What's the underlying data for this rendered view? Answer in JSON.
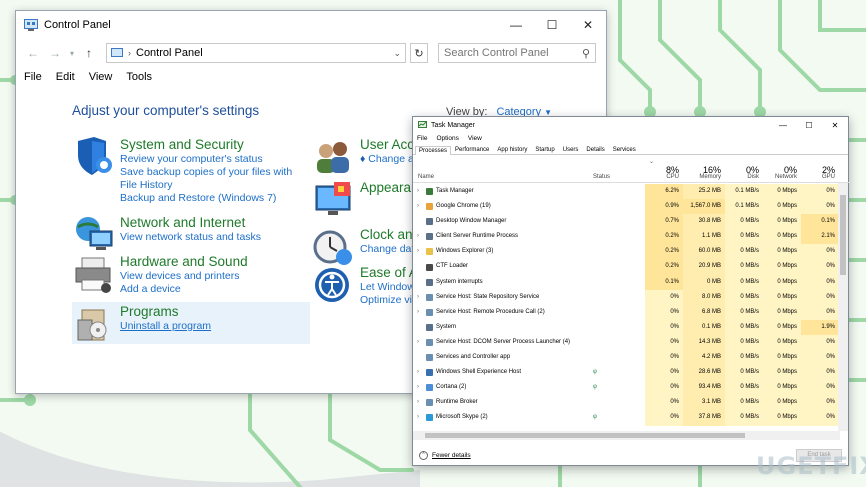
{
  "colors": {
    "accent": "#1e6fc8",
    "heading_green": "#1e7a2a",
    "circuit": "#8fd09a"
  },
  "control_panel": {
    "title": "Control Panel",
    "breadcrumb": "Control Panel",
    "search_placeholder": "Search Control Panel",
    "menu": [
      "File",
      "Edit",
      "View",
      "Tools"
    ],
    "adjust_heading": "Adjust your computer's settings",
    "view_by_label": "View by:",
    "view_by_value": "Category",
    "categories_left": [
      {
        "heading": "System and Security",
        "links": [
          "Review your computer's status",
          "Save backup copies of your files with File History",
          "Backup and Restore (Windows 7)"
        ],
        "icon": "shield-icon"
      },
      {
        "heading": "Network and Internet",
        "links": [
          "View network status and tasks"
        ],
        "icon": "network-icon"
      },
      {
        "heading": "Hardware and Sound",
        "links": [
          "View devices and printers",
          "Add a device"
        ],
        "icon": "printer-icon"
      },
      {
        "heading": "Programs",
        "links": [
          "Uninstall a program"
        ],
        "icon": "programs-icon"
      }
    ],
    "categories_right": [
      {
        "heading": "User Acco",
        "links": [
          "Change ac"
        ],
        "icon": "users-icon"
      },
      {
        "heading": "Appearan",
        "links": [],
        "icon": "appearance-icon"
      },
      {
        "heading": "Clock and",
        "links": [
          "Change date"
        ],
        "icon": "clock-icon"
      },
      {
        "heading": "Ease of Ac",
        "links": [
          "Let Windows",
          "Optimize visu"
        ],
        "icon": "ease-of-access-icon"
      }
    ]
  },
  "task_manager": {
    "title": "Task Manager",
    "menu": [
      "File",
      "Options",
      "View"
    ],
    "tabs": [
      "Processes",
      "Performance",
      "App history",
      "Startup",
      "Users",
      "Details",
      "Services"
    ],
    "active_tab": "Processes",
    "columns": {
      "name": "Name",
      "status": "Status",
      "cpu": {
        "pct": "8%",
        "label": "CPU"
      },
      "memory": {
        "pct": "16%",
        "label": "Memory"
      },
      "disk": {
        "pct": "0%",
        "label": "Disk"
      },
      "network": {
        "pct": "0%",
        "label": "Network"
      },
      "gpu": {
        "pct": "2%",
        "label": "GPU"
      }
    },
    "processes": [
      {
        "name": "Task Manager",
        "expand": true,
        "status": "",
        "cpu": "6.2%",
        "mem": "25.2 MB",
        "disk": "0.1 MB/s",
        "net": "0 Mbps",
        "gpu": "0%"
      },
      {
        "name": "Google Chrome (19)",
        "expand": true,
        "status": "",
        "cpu": "0.9%",
        "mem": "1,567.0 MB",
        "disk": "0.1 MB/s",
        "net": "0 Mbps",
        "gpu": "0%"
      },
      {
        "name": "Desktop Window Manager",
        "expand": false,
        "status": "",
        "cpu": "0.7%",
        "mem": "30.8 MB",
        "disk": "0 MB/s",
        "net": "0 Mbps",
        "gpu": "0.1%"
      },
      {
        "name": "Client Server Runtime Process",
        "expand": true,
        "status": "",
        "cpu": "0.2%",
        "mem": "1.1 MB",
        "disk": "0 MB/s",
        "net": "0 Mbps",
        "gpu": "2.1%"
      },
      {
        "name": "Windows Explorer (3)",
        "expand": true,
        "status": "",
        "cpu": "0.2%",
        "mem": "60.0 MB",
        "disk": "0 MB/s",
        "net": "0 Mbps",
        "gpu": "0%"
      },
      {
        "name": "CTF Loader",
        "expand": false,
        "status": "",
        "cpu": "0.2%",
        "mem": "20.9 MB",
        "disk": "0 MB/s",
        "net": "0 Mbps",
        "gpu": "0%"
      },
      {
        "name": "System interrupts",
        "expand": false,
        "status": "",
        "cpu": "0.1%",
        "mem": "0 MB",
        "disk": "0 MB/s",
        "net": "0 Mbps",
        "gpu": "0%"
      },
      {
        "name": "Service Host: State Repository Service",
        "expand": true,
        "status": "",
        "cpu": "0%",
        "mem": "8.0 MB",
        "disk": "0 MB/s",
        "net": "0 Mbps",
        "gpu": "0%"
      },
      {
        "name": "Service Host: Remote Procedure Call (2)",
        "expand": true,
        "status": "",
        "cpu": "0%",
        "mem": "6.8 MB",
        "disk": "0 MB/s",
        "net": "0 Mbps",
        "gpu": "0%"
      },
      {
        "name": "System",
        "expand": false,
        "status": "",
        "cpu": "0%",
        "mem": "0.1 MB",
        "disk": "0 MB/s",
        "net": "0 Mbps",
        "gpu": "1.9%"
      },
      {
        "name": "Service Host: DCOM Server Process Launcher (4)",
        "expand": true,
        "status": "",
        "cpu": "0%",
        "mem": "14.3 MB",
        "disk": "0 MB/s",
        "net": "0 Mbps",
        "gpu": "0%"
      },
      {
        "name": "Services and Controller app",
        "expand": false,
        "status": "",
        "cpu": "0%",
        "mem": "4.2 MB",
        "disk": "0 MB/s",
        "net": "0 Mbps",
        "gpu": "0%"
      },
      {
        "name": "Windows Shell Experience Host",
        "expand": true,
        "status": "φ",
        "cpu": "0%",
        "mem": "28.6 MB",
        "disk": "0 MB/s",
        "net": "0 Mbps",
        "gpu": "0%"
      },
      {
        "name": "Cortana (2)",
        "expand": true,
        "status": "φ",
        "cpu": "0%",
        "mem": "93.4 MB",
        "disk": "0 MB/s",
        "net": "0 Mbps",
        "gpu": "0%"
      },
      {
        "name": "Runtime Broker",
        "expand": true,
        "status": "",
        "cpu": "0%",
        "mem": "3.1 MB",
        "disk": "0 MB/s",
        "net": "0 Mbps",
        "gpu": "0%"
      },
      {
        "name": "Microsoft Skype (2)",
        "expand": true,
        "status": "φ",
        "cpu": "0%",
        "mem": "37.8 MB",
        "disk": "0 MB/s",
        "net": "0 Mbps",
        "gpu": "0%"
      }
    ],
    "fewer_details": "Fewer details",
    "end_task": "End task"
  },
  "watermark": "UGETFIX"
}
